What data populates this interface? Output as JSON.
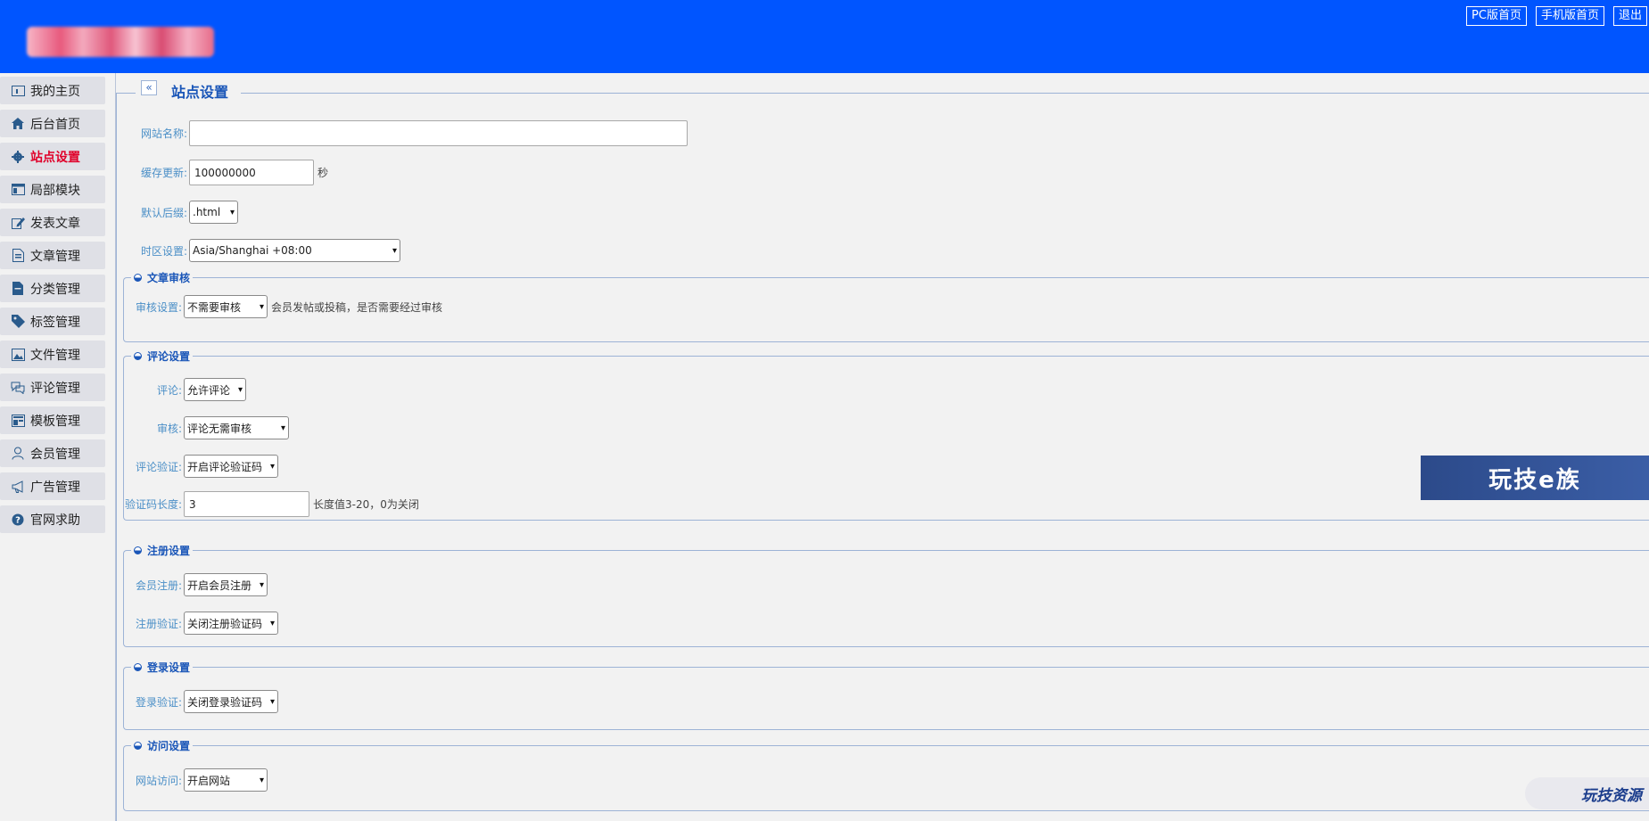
{
  "header": {
    "top_links": [
      "PC版首页",
      "手机版首页",
      "退出"
    ]
  },
  "sidebar": {
    "items": [
      {
        "label": "我的主页",
        "icon": "card-icon"
      },
      {
        "label": "后台首页",
        "icon": "home-icon"
      },
      {
        "label": "站点设置",
        "icon": "gear-icon",
        "active": true
      },
      {
        "label": "局部模块",
        "icon": "layout-icon"
      },
      {
        "label": "发表文章",
        "icon": "edit-icon"
      },
      {
        "label": "文章管理",
        "icon": "document-icon"
      },
      {
        "label": "分类管理",
        "icon": "file-icon"
      },
      {
        "label": "标签管理",
        "icon": "tag-icon"
      },
      {
        "label": "文件管理",
        "icon": "image-icon"
      },
      {
        "label": "评论管理",
        "icon": "comment-icon"
      },
      {
        "label": "模板管理",
        "icon": "template-icon"
      },
      {
        "label": "会员管理",
        "icon": "user-icon"
      },
      {
        "label": "广告管理",
        "icon": "megaphone-icon"
      },
      {
        "label": "官网求助",
        "icon": "help-icon"
      }
    ]
  },
  "main": {
    "collapse_label": "«",
    "title": "站点设置",
    "site_name": {
      "label": "网站名称:",
      "value": ""
    },
    "cache": {
      "label": "缓存更新:",
      "value": "100000000",
      "unit": "秒"
    },
    "suffix": {
      "label": "默认后缀:",
      "value": ".html"
    },
    "timezone": {
      "label": "时区设置:",
      "value": "Asia/Shanghai +08:00"
    }
  },
  "sections": {
    "audit": {
      "legend": "文章审核",
      "review": {
        "label": "审核设置:",
        "value": "不需要审核",
        "hint": "会员发帖或投稿，是否需要经过审核"
      }
    },
    "comment": {
      "legend": "评论设置",
      "comment": {
        "label": "评论:",
        "value": "允许评论"
      },
      "review": {
        "label": "审核:",
        "value": "评论无需审核"
      },
      "captcha": {
        "label": "评论验证:",
        "value": "开启评论验证码"
      },
      "captcha_len": {
        "label": "验证码长度:",
        "value": "3",
        "hint": "长度值3-20，0为关闭"
      }
    },
    "register": {
      "legend": "注册设置",
      "member": {
        "label": "会员注册:",
        "value": "开启会员注册"
      },
      "captcha": {
        "label": "注册验证:",
        "value": "关闭注册验证码"
      }
    },
    "login": {
      "legend": "登录设置",
      "captcha": {
        "label": "登录验证:",
        "value": "关闭登录验证码"
      }
    },
    "access": {
      "legend": "访问设置",
      "site": {
        "label": "网站访问:",
        "value": "开启网站"
      }
    }
  },
  "banner": {
    "text": "玩技e族"
  },
  "watermark": {
    "text": "玩技资源"
  },
  "colors": {
    "header": "#0055ff",
    "accent": "#1a56b8",
    "label": "#4b8fc7",
    "active": "#e0002a"
  }
}
